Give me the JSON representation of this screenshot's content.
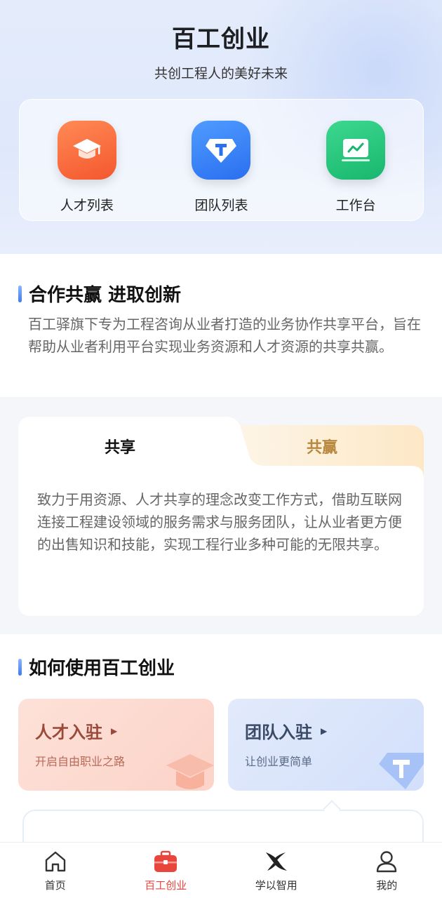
{
  "hero": {
    "title": "百工创业",
    "subtitle": "共创工程人的美好未来"
  },
  "quick_links": [
    {
      "label": "人才列表",
      "icon": "graduation-cap-icon",
      "color": "#f4572e"
    },
    {
      "label": "团队列表",
      "icon": "team-diamond-icon",
      "color": "#2a6ff0"
    },
    {
      "label": "工作台",
      "icon": "workbench-chart-icon",
      "color": "#18b66e"
    }
  ],
  "about": {
    "heading": "合作共赢 进取创新",
    "body": "百工驿旗下专为工程咨询从业者打造的业务协作共享平台，旨在帮助从业者利用平台实现业务资源和人才资源的共享共赢。"
  },
  "share_tabs": {
    "tabs": [
      "共享",
      "共赢"
    ],
    "active": "共享",
    "body": "致力于用资源、人才共享的理念改变工作方式，借助互联网连接工程建设领域的服务需求与服务团队，让从业者更方便的出售知识和技能，实现工程行业多种可能的无限共享。"
  },
  "how_to": {
    "heading": "如何使用百工创业",
    "cards": [
      {
        "title": "人才入驻",
        "subtitle": "开启自由职业之路"
      },
      {
        "title": "团队入驻",
        "subtitle": "让创业更简单"
      }
    ]
  },
  "tabbar": {
    "items": [
      {
        "label": "首页",
        "icon": "home-icon"
      },
      {
        "label": "百工创业",
        "icon": "briefcase-icon"
      },
      {
        "label": "学以智用",
        "icon": "x-logo-icon"
      },
      {
        "label": "我的",
        "icon": "user-icon"
      }
    ],
    "active": "百工创业",
    "active_color": "#e8453c"
  }
}
